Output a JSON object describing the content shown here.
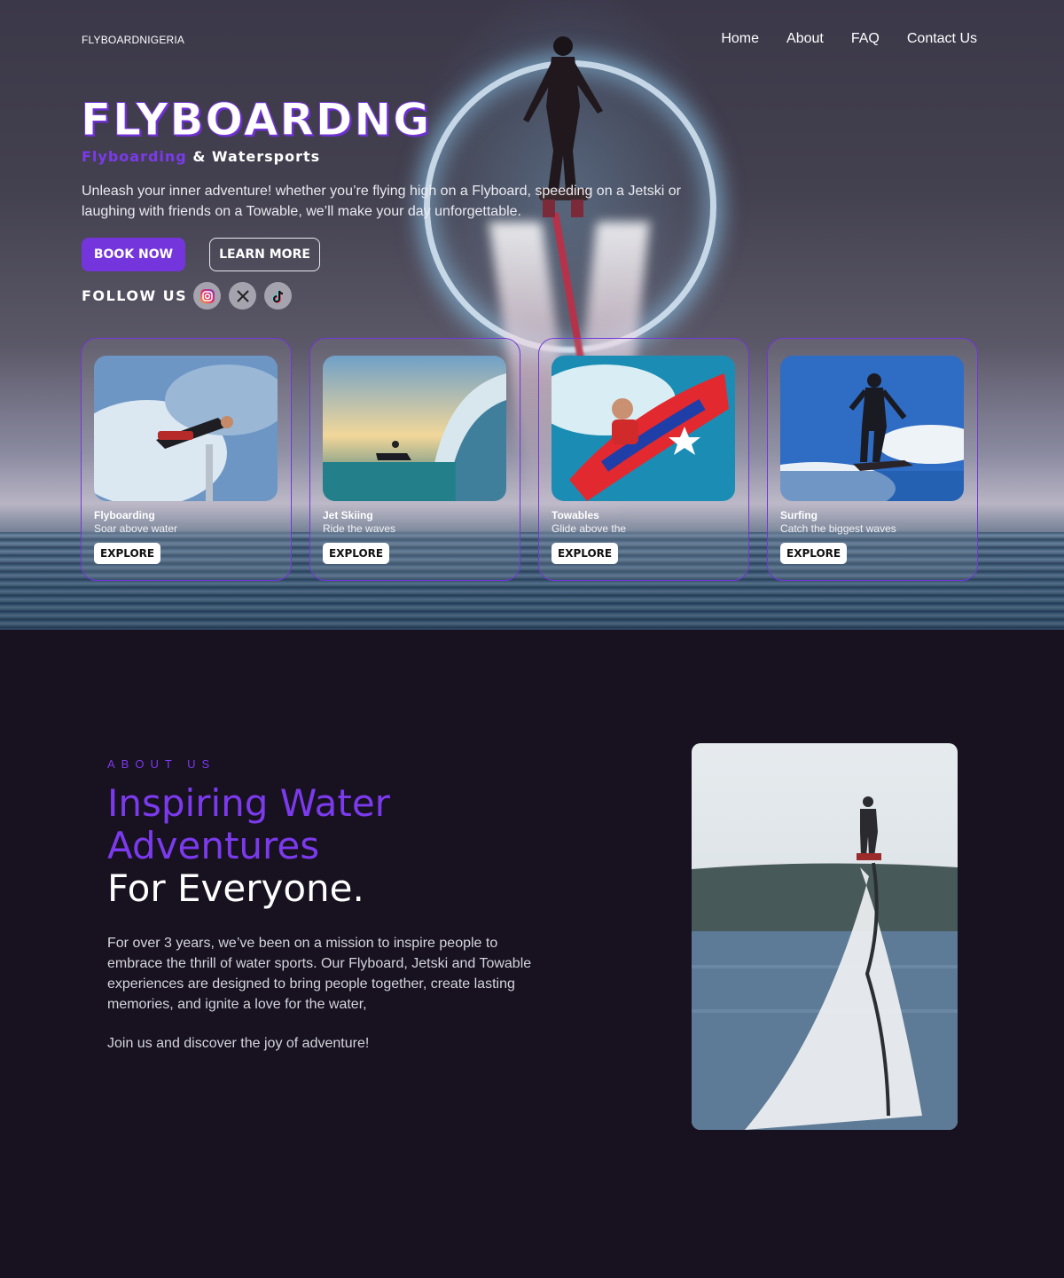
{
  "header": {
    "brand": "FLYBOARDNIGERIA",
    "nav": [
      {
        "label": "Home"
      },
      {
        "label": "About"
      },
      {
        "label": "FAQ"
      },
      {
        "label": "Contact Us"
      }
    ]
  },
  "hero": {
    "title": "FLYBOARDNG",
    "subtitle_accent": "Flyboarding",
    "subtitle_rest": " & Watersports",
    "description": "Unleash your inner adventure! whether you’re flying high on a Flyboard, speeding on a Jetski or laughing with friends on a Towable, we’ll make your day unforgettable.",
    "book_label": "BOOK NOW",
    "learn_label": "LEARN MORE",
    "follow_label": "FOLLOW US",
    "social_icons": [
      "instagram-icon",
      "x-icon",
      "tiktok-icon"
    ]
  },
  "cards": [
    {
      "title": "Flyboarding",
      "subtitle": "Soar above water",
      "button": "EXPLORE"
    },
    {
      "title": "Jet Skiing",
      "subtitle": "Ride the waves",
      "button": "EXPLORE"
    },
    {
      "title": "Towables",
      "subtitle": "Glide above the",
      "button": "EXPLORE"
    },
    {
      "title": "Surfing",
      "subtitle": "Catch the biggest waves",
      "button": "EXPLORE"
    }
  ],
  "about": {
    "kicker": "ABOUT US",
    "heading_line1": "Inspiring Water",
    "heading_line2": "Adventures",
    "heading_line3": "For Everyone.",
    "paragraph": "For over 3 years, we’ve been on a mission to inspire people to embrace the thrill of water sports. Our Flyboard, Jetski and Towable experiences are designed to bring people together, create lasting memories, and ignite a love for the water,",
    "closing": "Join us and discover the joy of adventure!"
  },
  "colors": {
    "accent": "#7535dc",
    "background": "#171120"
  }
}
